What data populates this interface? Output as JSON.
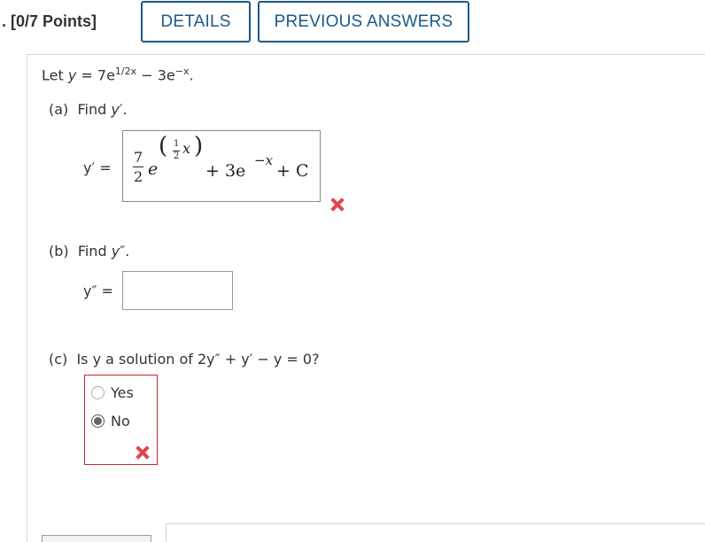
{
  "header": {
    "points": ". [0/7 Points]",
    "details_label": "DETAILS",
    "previous_answers_label": "PREVIOUS ANSWERS"
  },
  "problem": {
    "let_prefix": "Let ",
    "y_var": "y",
    "eq_sign": " = 7e",
    "exp1": "1/2x",
    "minus": " − 3e",
    "exp2": "−x",
    "period": "."
  },
  "part_a": {
    "label": "(a)",
    "prompt_prefix": "Find ",
    "prompt_var": "y′",
    "prompt_suffix": ".",
    "answer_label": "y′ =",
    "answer": {
      "coef_num": "7",
      "coef_den": "2",
      "base": "e",
      "exp_open": "(",
      "exp_num": "1",
      "exp_den": "2",
      "exp_var": "x",
      "exp_close": ")",
      "rest": "+ 3e",
      "rest_exp": "−x",
      "tail": "+ C"
    },
    "status": "incorrect"
  },
  "part_b": {
    "label": "(b)",
    "prompt_prefix": "Find ",
    "prompt_var": "y″",
    "prompt_suffix": ".",
    "answer_label": "y″ =",
    "answer_value": ""
  },
  "part_c": {
    "label": "(c)",
    "question": "Is y a solution of 2y″ + y′ − y = 0?",
    "options": [
      "Yes",
      "No"
    ],
    "selected": "No",
    "status": "incorrect"
  },
  "colors": {
    "accent": "#1a5a8a",
    "error": "#e0454c",
    "error_border": "#c4262e"
  }
}
